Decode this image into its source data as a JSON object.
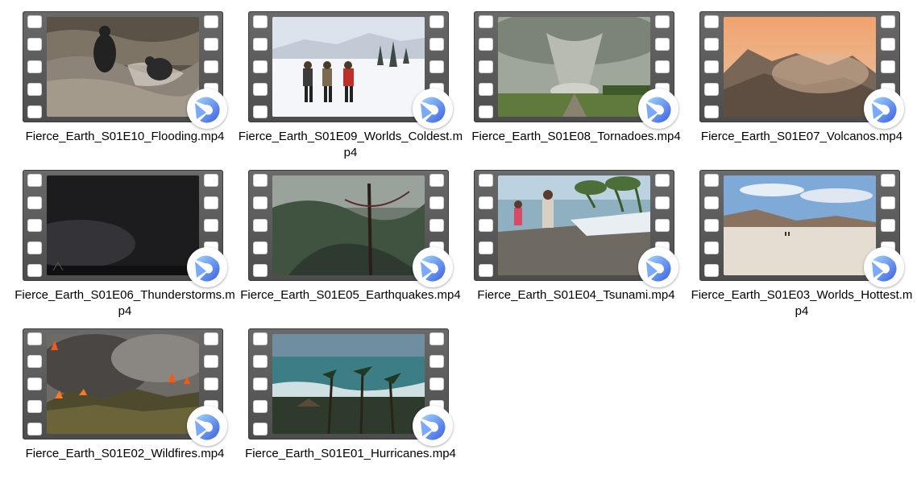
{
  "files": [
    {
      "name": "Fierce_Earth_S01E10_Flooding.mp4",
      "scene": "flooding",
      "icon": "video-player-icon"
    },
    {
      "name": "Fierce_Earth_S01E09_Worlds_Coldest.mp4",
      "scene": "coldest",
      "icon": "video-player-icon"
    },
    {
      "name": "Fierce_Earth_S01E08_Tornadoes.mp4",
      "scene": "tornado",
      "icon": "video-player-icon"
    },
    {
      "name": "Fierce_Earth_S01E07_Volcanos.mp4",
      "scene": "volcano",
      "icon": "video-player-icon"
    },
    {
      "name": "Fierce_Earth_S01E06_Thunderstorms.mp4",
      "scene": "thunderstorm",
      "icon": "video-player-icon"
    },
    {
      "name": "Fierce_Earth_S01E05_Earthquakes.mp4",
      "scene": "earthquake",
      "icon": "video-player-icon"
    },
    {
      "name": "Fierce_Earth_S01E04_Tsunami.mp4",
      "scene": "tsunami",
      "icon": "video-player-icon"
    },
    {
      "name": "Fierce_Earth_S01E03_Worlds_Hottest.mp4",
      "scene": "hottest",
      "icon": "video-player-icon"
    },
    {
      "name": "Fierce_Earth_S01E02_Wildfires.mp4",
      "scene": "wildfire",
      "icon": "video-player-icon"
    },
    {
      "name": "Fierce_Earth_S01E01_Hurricanes.mp4",
      "scene": "hurricane",
      "icon": "video-player-icon"
    }
  ]
}
